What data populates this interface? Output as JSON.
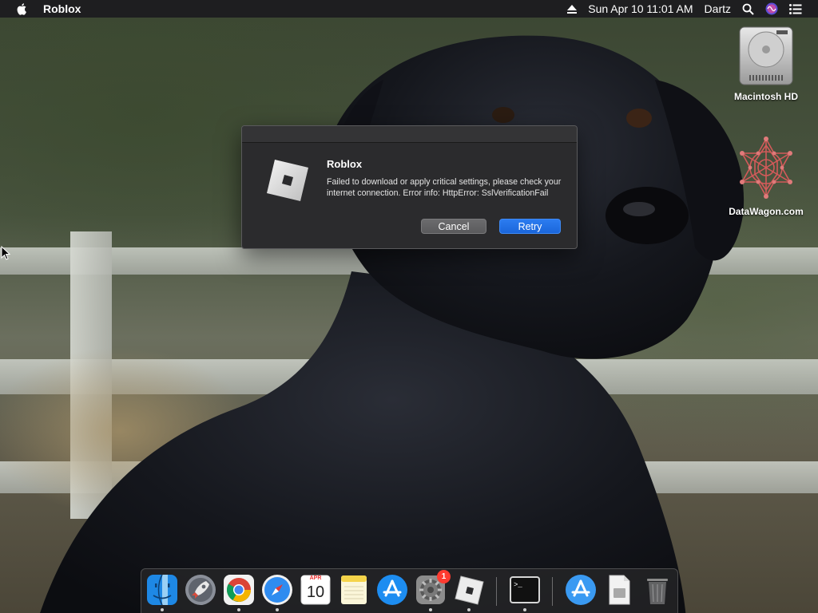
{
  "menubar": {
    "app_name": "Roblox",
    "clock": "Sun Apr 10  11:01 AM",
    "user": "Dartz",
    "icons": [
      "apple-icon",
      "eject-icon",
      "spotlight-search-icon",
      "siri-icon",
      "notification-center-icon"
    ]
  },
  "desktop": {
    "icons": [
      {
        "name": "Macintosh HD",
        "icon": "hard-drive-icon"
      },
      {
        "name": "DataWagon.com",
        "icon": "datawagon-logo-icon"
      }
    ]
  },
  "dialog": {
    "title": "Roblox",
    "message": "Failed to download or apply critical settings, please check your internet connection. Error info: HttpError: SslVerificationFail",
    "cancel_label": "Cancel",
    "retry_label": "Retry",
    "icon": "roblox-icon"
  },
  "dock": {
    "items": [
      {
        "name": "Finder",
        "icon": "finder-icon",
        "running": true
      },
      {
        "name": "Launchpad",
        "icon": "launchpad-icon",
        "running": false
      },
      {
        "name": "Google Chrome",
        "icon": "chrome-icon",
        "running": true
      },
      {
        "name": "Safari",
        "icon": "safari-icon",
        "running": true
      },
      {
        "name": "Calendar",
        "icon": "calendar-icon",
        "running": false,
        "month": "APR",
        "day": "10"
      },
      {
        "name": "Notes",
        "icon": "notes-icon",
        "running": false
      },
      {
        "name": "App Store",
        "icon": "app-store-icon",
        "running": false
      },
      {
        "name": "System Preferences",
        "icon": "system-preferences-icon",
        "running": true,
        "badge": "1"
      },
      {
        "name": "Roblox",
        "icon": "roblox-icon",
        "running": true
      },
      {
        "name": "Terminal",
        "icon": "terminal-icon",
        "running": true
      },
      {
        "name": "Applications",
        "icon": "applications-folder-icon",
        "running": false
      },
      {
        "name": "Documents",
        "icon": "document-icon",
        "running": false
      },
      {
        "name": "Trash",
        "icon": "trash-icon",
        "running": false
      }
    ]
  },
  "colors": {
    "menubar": "#1e1e20",
    "dialog_bg": "#2b2b2d",
    "accent_blue": "#1a66db",
    "badge_red": "#ff3b30"
  }
}
